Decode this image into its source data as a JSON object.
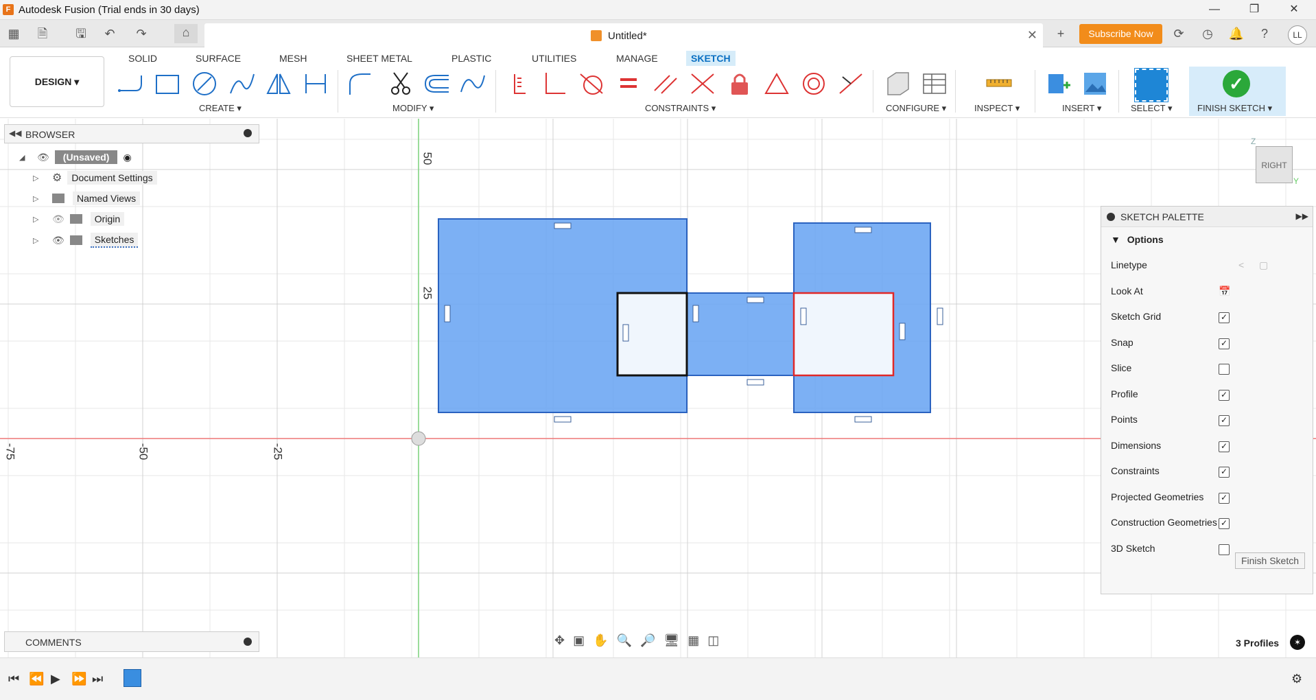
{
  "window": {
    "title": "Autodesk Fusion (Trial ends in 30 days)",
    "app_icon": "F"
  },
  "document_tab": {
    "title": "Untitled*"
  },
  "header": {
    "subscribe": "Subscribe Now",
    "avatar": "LL"
  },
  "toolbar": {
    "design": "DESIGN ▾",
    "tabs": [
      "SOLID",
      "SURFACE",
      "MESH",
      "SHEET METAL",
      "PLASTIC",
      "UTILITIES",
      "MANAGE",
      "SKETCH"
    ],
    "active_tab": "SKETCH",
    "groups": {
      "create": "CREATE ▾",
      "modify": "MODIFY ▾",
      "constraints": "CONSTRAINTS ▾",
      "configure": "CONFIGURE ▾",
      "inspect": "INSPECT ▾",
      "insert": "INSERT ▾",
      "select": "SELECT ▾",
      "finish": "FINISH SKETCH ▾"
    }
  },
  "browser": {
    "title": "BROWSER",
    "items": [
      "(Unsaved)",
      "Document Settings",
      "Named Views",
      "Origin",
      "Sketches"
    ]
  },
  "comments": {
    "title": "COMMENTS"
  },
  "axis_labels": {
    "v50": "50",
    "v25": "25",
    "hm75": "-75",
    "hm50": "-50",
    "hm25": "-25"
  },
  "palette": {
    "title": "SKETCH PALETTE",
    "section": "Options",
    "rows": [
      {
        "label": "Linetype",
        "checked": null
      },
      {
        "label": "Look At",
        "checked": null
      },
      {
        "label": "Sketch Grid",
        "checked": true
      },
      {
        "label": "Snap",
        "checked": true
      },
      {
        "label": "Slice",
        "checked": false
      },
      {
        "label": "Profile",
        "checked": true
      },
      {
        "label": "Points",
        "checked": true
      },
      {
        "label": "Dimensions",
        "checked": true
      },
      {
        "label": "Constraints",
        "checked": true
      },
      {
        "label": "Projected Geometries",
        "checked": true
      },
      {
        "label": "Construction Geometries",
        "checked": true
      },
      {
        "label": "3D Sketch",
        "checked": false
      }
    ],
    "finish_button": "Finish Sketch"
  },
  "viewcube": {
    "face": "RIGHT",
    "z": "Z",
    "y": "Y"
  },
  "status": {
    "profiles": "3 Profiles"
  },
  "colors": {
    "accent": "#0a6fc2",
    "profile_fill": "#5b9cf0",
    "selection": "#e02828",
    "finish": "#2ba83a",
    "subscribe": "#f28c1a"
  }
}
